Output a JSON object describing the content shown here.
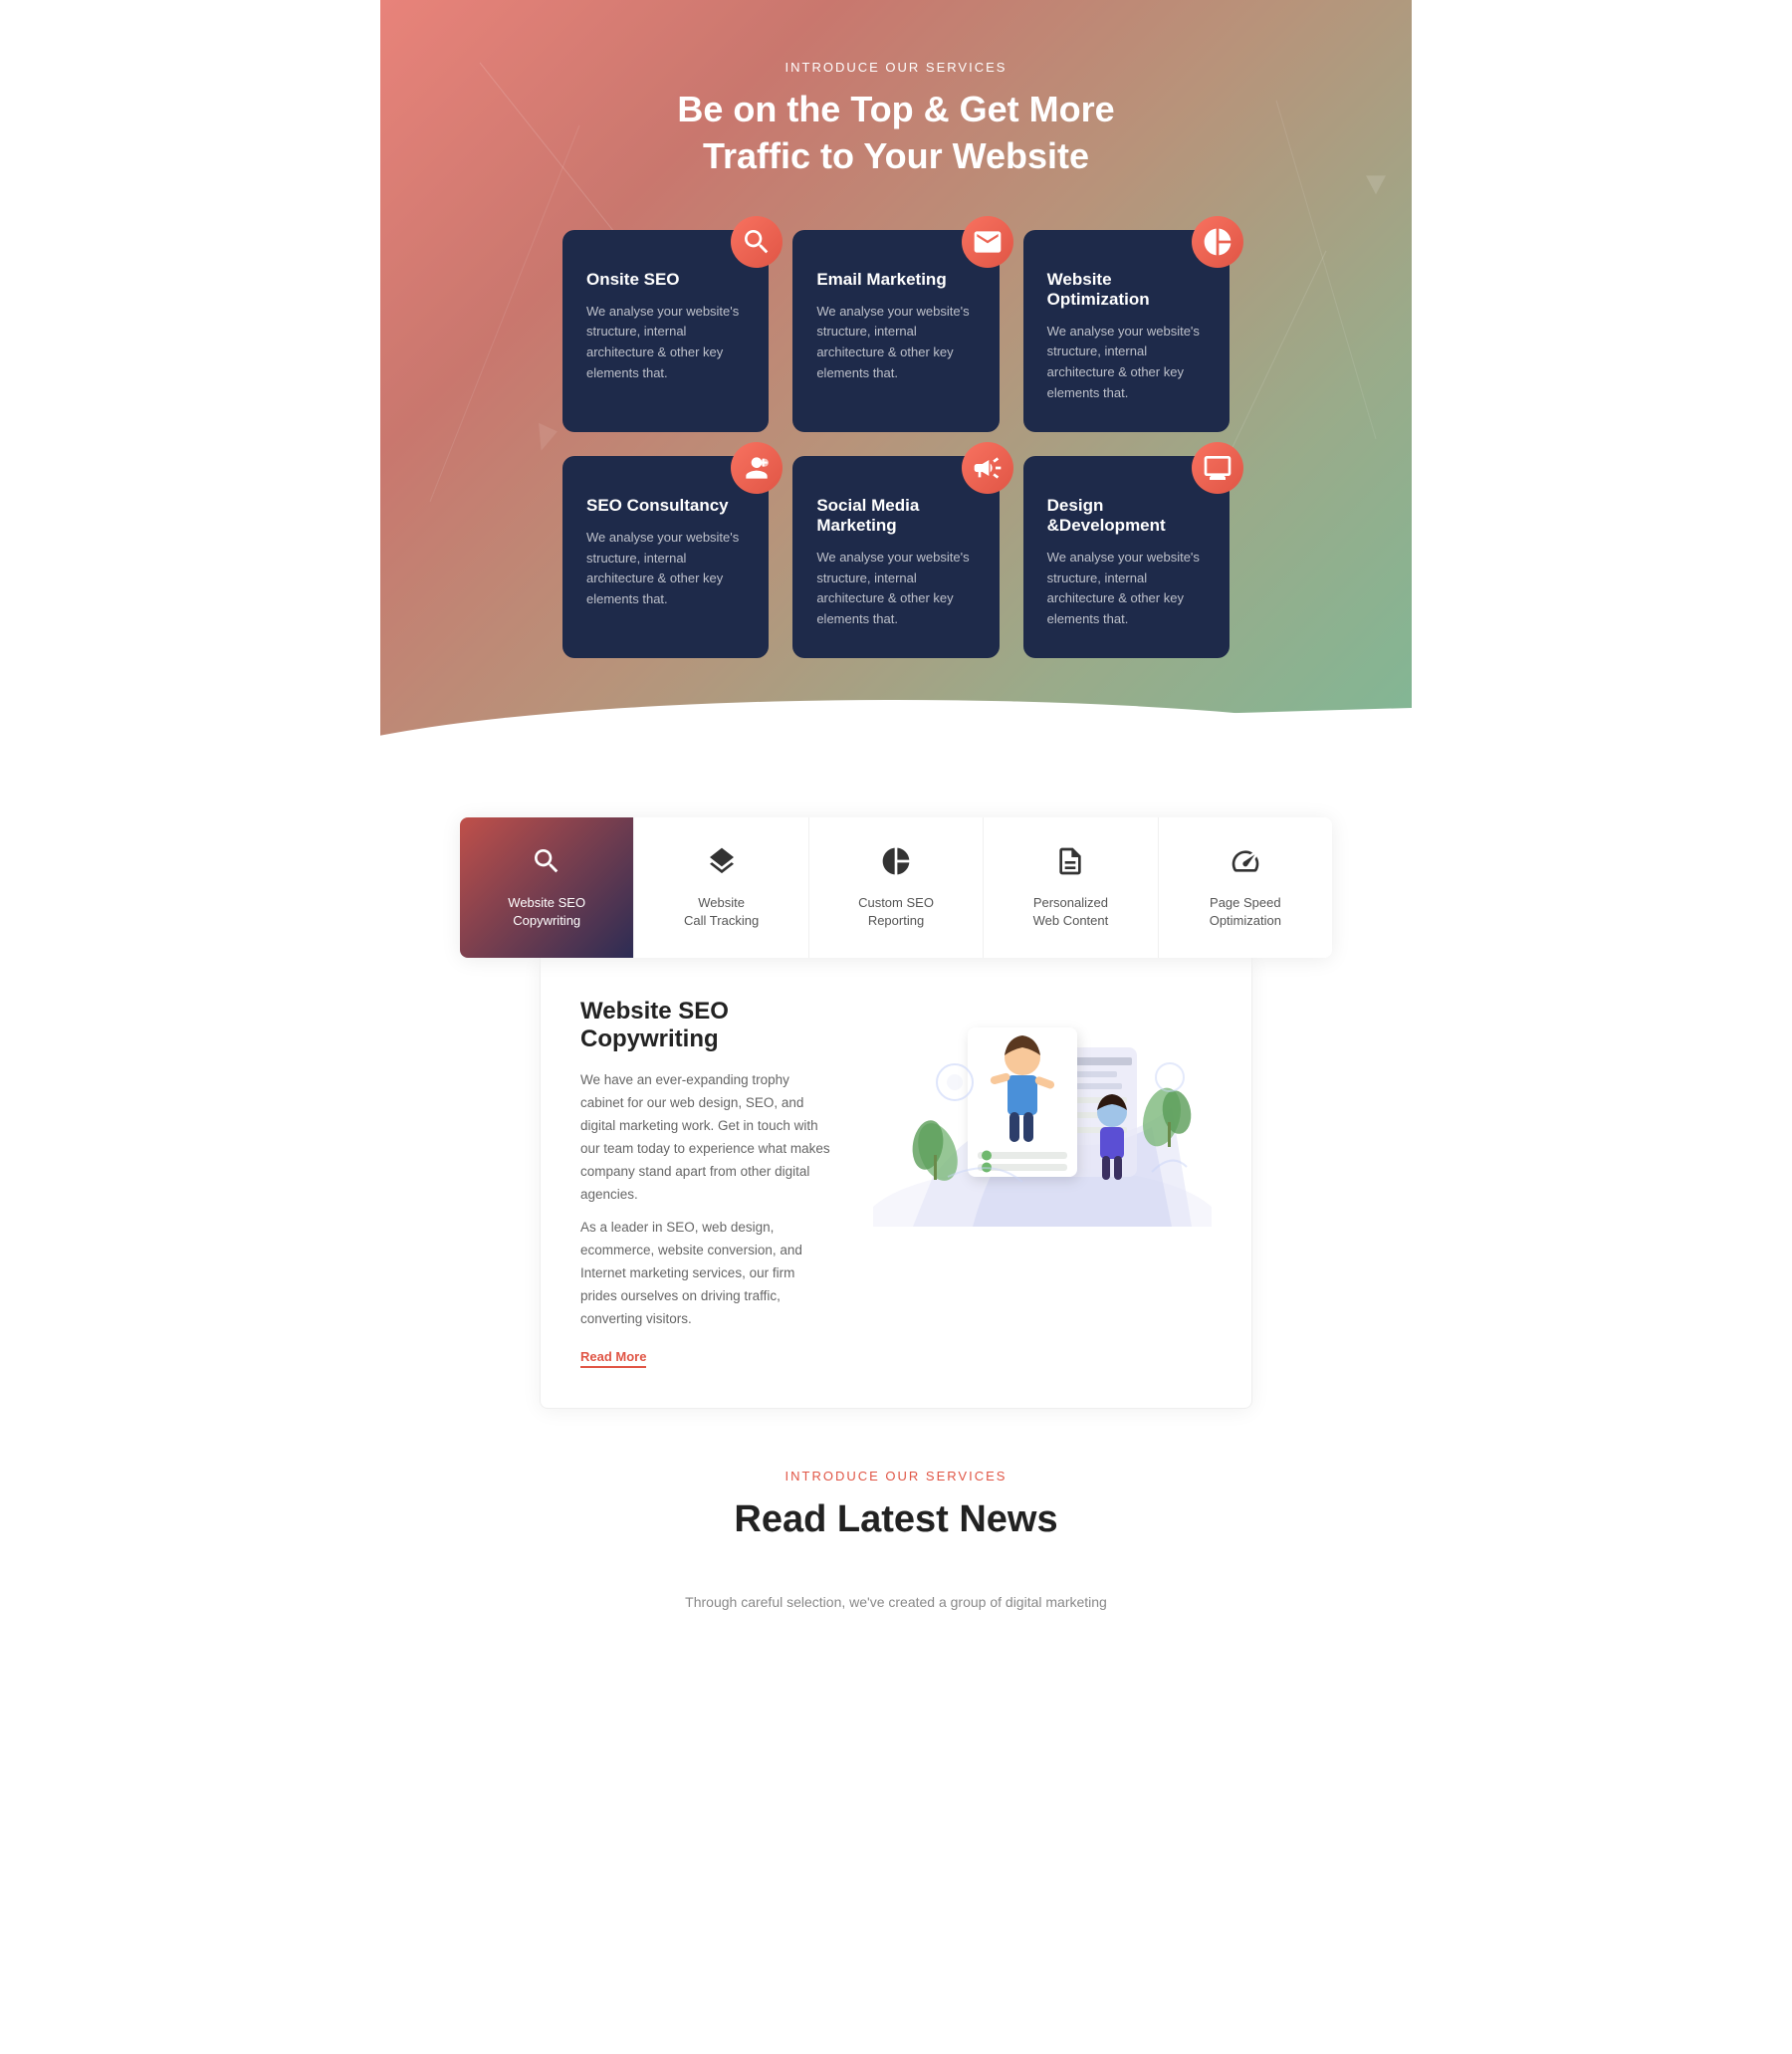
{
  "services": {
    "label": "INTRODUCE OUR SERVICES",
    "title_line1": "Be on the Top & Get More",
    "title_line2": "Traffic to Your Website",
    "cards": [
      {
        "id": "onsite-seo",
        "title": "Onsite SEO",
        "description": "We analyse your website's structure, internal architecture & other key elements that.",
        "icon": "search"
      },
      {
        "id": "email-marketing",
        "title": "Email Marketing",
        "description": "We analyse your website's structure, internal architecture & other key elements that.",
        "icon": "email"
      },
      {
        "id": "website-optimization",
        "title": "Website Optimization",
        "description": "We analyse your website's structure, internal architecture & other key elements that.",
        "icon": "pie"
      },
      {
        "id": "seo-consultancy",
        "title": "SEO Consultancy",
        "description": "We analyse your website's structure, internal architecture & other key elements that.",
        "icon": "person"
      },
      {
        "id": "social-media",
        "title": "Social Media Marketing",
        "description": "We analyse your website's structure, internal architecture & other key elements that.",
        "icon": "megaphone"
      },
      {
        "id": "design-dev",
        "title": "Design &Development",
        "description": "We analyse your website's structure, internal architecture & other key elements that.",
        "icon": "monitor"
      }
    ]
  },
  "tabs": {
    "items": [
      {
        "id": "seo-copywriting",
        "label_line1": "Website SEO",
        "label_line2": "Copywriting",
        "icon": "search",
        "active": true
      },
      {
        "id": "call-tracking",
        "label_line1": "Website",
        "label_line2": "Call Tracking",
        "icon": "layers",
        "active": false
      },
      {
        "id": "custom-seo",
        "label_line1": "Custom SEO",
        "label_line2": "Reporting",
        "icon": "pie-chart",
        "active": false
      },
      {
        "id": "web-content",
        "label_line1": "Personalized",
        "label_line2": "Web Content",
        "icon": "document",
        "active": false
      },
      {
        "id": "page-speed",
        "label_line1": "Page Speed",
        "label_line2": "Optimization",
        "icon": "speedometer",
        "active": false
      }
    ]
  },
  "content_panel": {
    "title": "Website SEO Copywriting",
    "paragraph1": "We have an ever-expanding trophy cabinet for our web design, SEO, and digital marketing work. Get in touch with our team today to experience what makes company stand apart from other digital agencies.",
    "paragraph2": "As a leader in SEO, web design, ecommerce, website conversion, and Internet marketing services, our firm prides ourselves on driving traffic, converting visitors.",
    "read_more": "Read More"
  },
  "news_section": {
    "label": "INTRODUCE OUR SERVICES",
    "title": "Read Latest News",
    "subtitle": "Through careful selection, we've created a group of digital marketing"
  }
}
